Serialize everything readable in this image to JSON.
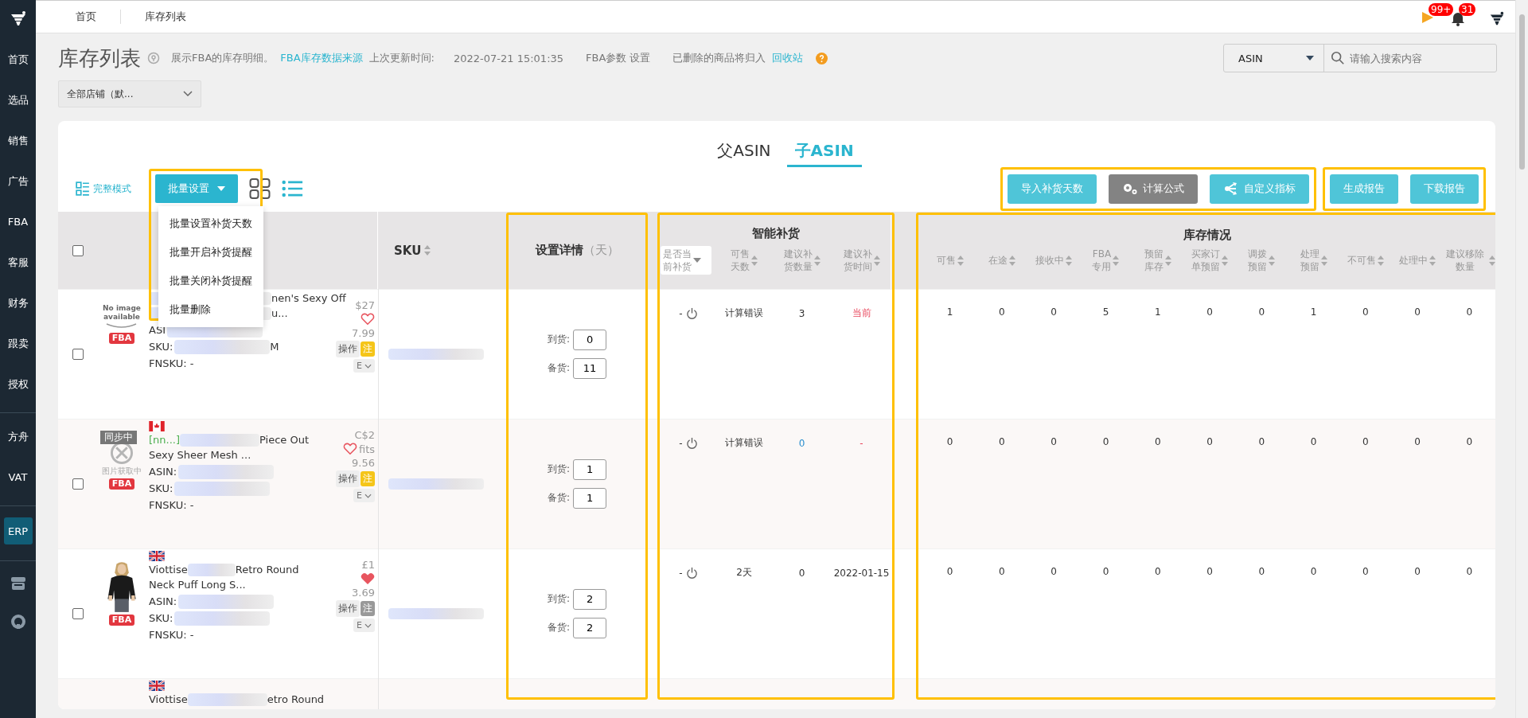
{
  "sidebar": {
    "groups": [
      [
        {
          "label": "首页",
          "selected": false
        },
        {
          "label": "选品",
          "selected": false
        },
        {
          "label": "销售",
          "selected": false
        },
        {
          "label": "广告",
          "selected": false
        },
        {
          "label": "FBA",
          "selected": false
        },
        {
          "label": "客服",
          "selected": false
        },
        {
          "label": "财务",
          "selected": false
        },
        {
          "label": "跟卖",
          "selected": false
        },
        {
          "label": "授权",
          "selected": false
        }
      ],
      [
        {
          "label": "方舟",
          "selected": false
        },
        {
          "label": "VAT",
          "selected": false
        }
      ],
      [
        {
          "label": "ERP",
          "selected": true
        }
      ]
    ]
  },
  "top_tabs": [
    {
      "label": "首页"
    },
    {
      "label": "库存列表"
    }
  ],
  "notifications": [
    {
      "kind": "flag",
      "count": "99+"
    },
    {
      "kind": "bell",
      "count": "31"
    }
  ],
  "header": {
    "title": "库存列表",
    "description": "展示FBA的库存明细。",
    "source_link": "FBA库存数据来源",
    "updated_label": "上次更新时间:",
    "updated_time": "2022-07-21 15:01:35",
    "fba_params": "FBA参数 设置",
    "recycle_note": "已删除的商品将归入",
    "recycle_link": "回收站"
  },
  "store_select": {
    "value": "全部店铺（默..."
  },
  "search": {
    "field": "ASIN",
    "placeholder": "请输入搜索内容"
  },
  "asin_tabs": [
    {
      "label": "父ASIN",
      "selected": false
    },
    {
      "label": "子ASIN",
      "selected": true
    }
  ],
  "toolbar": {
    "mode_link": "完整模式",
    "batch": {
      "label": "批量设置",
      "expanded": true,
      "highlighted": true,
      "items": [
        "批量设置补货天数",
        "批量开启补货提醒",
        "批量关闭补货提醒",
        "批量删除"
      ]
    },
    "button_groups": [
      {
        "highlighted": true,
        "buttons": [
          {
            "label": "导入补货天数",
            "kind": "primary"
          },
          {
            "label": "计算公式",
            "kind": "formula"
          },
          {
            "label": "自定义指标",
            "kind": "metric"
          }
        ]
      },
      {
        "highlighted": true,
        "buttons": [
          {
            "label": "生成报告",
            "kind": "primary"
          },
          {
            "label": "下载报告",
            "kind": "primary"
          }
        ]
      }
    ]
  },
  "table": {
    "select_all": {
      "checked": false
    },
    "columns": {
      "sku": {
        "label": "SKU"
      },
      "settings": {
        "label": "设置详情",
        "unit": "（天）",
        "highlighted": true
      },
      "smart": {
        "label": "智能补货",
        "highlighted": true,
        "filter": [
          "是否当",
          "前补货"
        ],
        "subcolumns": [
          [
            "可售",
            "天数"
          ],
          [
            "建议补",
            "货数量"
          ],
          [
            "建议补",
            "货时间"
          ]
        ]
      },
      "inventory": {
        "label": "库存情况",
        "highlighted": true,
        "subcolumns": [
          [
            "可售"
          ],
          [
            "在途"
          ],
          [
            "接收中"
          ],
          [
            "FBA",
            "专用"
          ],
          [
            "预留",
            "库存"
          ],
          [
            "买家订",
            "单预留"
          ],
          [
            "调拨",
            "预留"
          ],
          [
            "处理",
            "预留"
          ],
          [
            "不可售"
          ],
          [
            "处理中"
          ],
          [
            "建议移除数量"
          ]
        ]
      }
    },
    "rows": [
      {
        "checked": false,
        "image": {
          "kind": "no-image",
          "text": "No image available"
        },
        "fba": "FBA",
        "title": [
          {
            "redacted": true,
            "post": "nen's Sexy Off"
          },
          {
            "redacted": true,
            "post": "u..."
          }
        ],
        "asin": "ASI",
        "sku": {
          "label": "SKU:",
          "post": "M"
        },
        "fnsku": "FNSKU:  -",
        "side": {
          "price": "$27",
          "price2": "7.99",
          "favorite": false,
          "action": "操作",
          "note": "注",
          "note_active": true,
          "more": "E"
        },
        "arrival_label": "到货:",
        "arrival": "0",
        "stock_label": "备货:",
        "stock": "11",
        "smart": {
          "status": "-",
          "power": false,
          "days": "计算错误",
          "qty": "3",
          "qty_link": false,
          "time": "当前",
          "time_alert": true
        },
        "inventory": [
          "1",
          "0",
          "0",
          "5",
          "1",
          "0",
          "0",
          "1",
          "0",
          "0",
          "0"
        ]
      },
      {
        "checked": false,
        "image": {
          "kind": "loading",
          "text": "图片获取中"
        },
        "sync": "同步中",
        "fba": "FBA",
        "flag": {
          "kind": "ca"
        },
        "title": [
          {
            "pre": "[nn...]",
            "redacted": true,
            "post": "Piece Out"
          },
          {
            "pre": "Sexy Sheer Mesh ..."
          }
        ],
        "asin": "ASIN:",
        "sku": {
          "label": "SKU:"
        },
        "fnsku": "FNSKU:  -",
        "side": {
          "price": "C$2",
          "extra": "fits",
          "price2": "9.56",
          "favorite": false,
          "action": "操作",
          "note": "注",
          "note_active": true,
          "more": "E"
        },
        "arrival_label": "到货:",
        "arrival": "1",
        "stock_label": "备货:",
        "stock": "1",
        "smart": {
          "status": "-",
          "power": false,
          "days": "计算错误",
          "qty": "0",
          "qty_link": true,
          "time": "-",
          "time_alert": true
        },
        "inventory": [
          "0",
          "0",
          "0",
          "0",
          "0",
          "0",
          "0",
          "0",
          "0",
          "0",
          "0"
        ]
      },
      {
        "checked": false,
        "image": {
          "kind": "picture"
        },
        "fba": "FBA",
        "flag": {
          "kind": "uk"
        },
        "title": [
          {
            "pre": "Viottise",
            "redacted": true,
            "post": "Retro Round"
          },
          {
            "pre": "Neck Puff Long S..."
          }
        ],
        "asin": "ASIN:",
        "sku": {
          "label": "SKU:"
        },
        "fnsku": "FNSKU:  -",
        "side": {
          "price": "£1",
          "price2": "3.69",
          "favorite": true,
          "action": "操作",
          "note": "注",
          "note_active": false,
          "more": "E"
        },
        "arrival_label": "到货:",
        "arrival": "2",
        "stock_label": "备货:",
        "stock": "2",
        "smart": {
          "status": "-",
          "power": false,
          "days": "2天",
          "qty": "0",
          "qty_link": false,
          "time": "2022-01-15",
          "time_alert": false
        },
        "inventory": [
          "0",
          "0",
          "0",
          "0",
          "0",
          "0",
          "0",
          "0",
          "0",
          "0",
          "0"
        ]
      },
      {
        "flag": {
          "kind": "uk"
        },
        "title": [
          {
            "pre": "Viottise",
            "redacted": true,
            "post": "etro Round"
          }
        ]
      }
    ]
  }
}
